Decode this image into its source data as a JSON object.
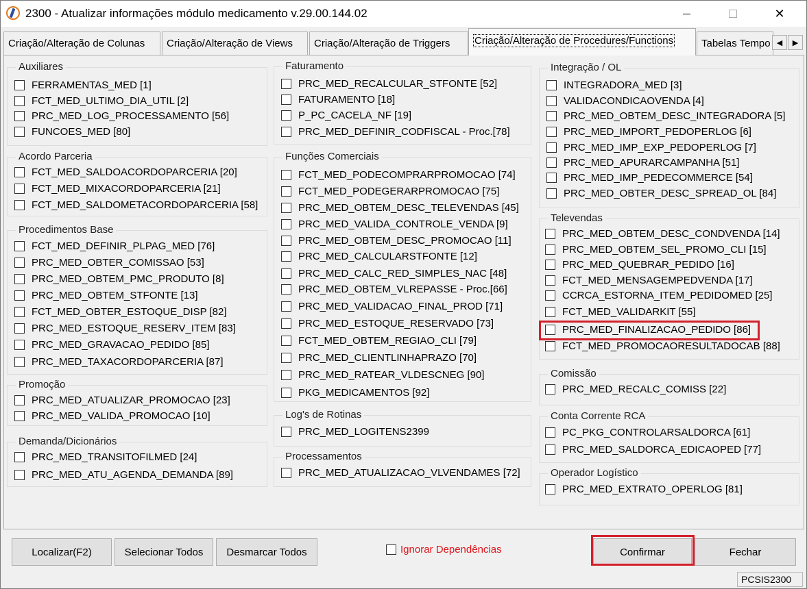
{
  "title": "2300 - Atualizar informações módulo medicamento v.29.00.144.02",
  "tabs": [
    "Criação/Alteração de Colunas",
    "Criação/Alteração de Views",
    "Criação/Alteração de Triggers",
    "Criação/Alteração de Procedures/Functions",
    "Tabelas Tempo"
  ],
  "groups": {
    "auxiliares": {
      "title": "Auxiliares",
      "items": [
        "FERRAMENTAS_MED [1]",
        "FCT_MED_ULTIMO_DIA_UTIL [2]",
        "PRC_MED_LOG_PROCESSAMENTO [56]",
        "FUNCOES_MED [80]"
      ]
    },
    "acordo": {
      "title": "Acordo Parceria",
      "items": [
        "FCT_MED_SALDOACORDOPARCERIA [20]",
        "FCT_MED_MIXACORDOPARCERIA [21]",
        "FCT_MED_SALDOMETACORDOPARCERIA [58]"
      ]
    },
    "procedimentos": {
      "title": "Procedimentos Base",
      "items": [
        "FCT_MED_DEFINIR_PLPAG_MED [76]",
        "PRC_MED_OBTER_COMISSAO [53]",
        "PRC_MED_OBTEM_PMC_PRODUTO [8]",
        "PRC_MED_OBTEM_STFONTE [13]",
        "FCT_MED_OBTER_ESTOQUE_DISP [82]",
        "PRC_MED_ESTOQUE_RESERV_ITEM [83]",
        "PRC_MED_GRAVACAO_PEDIDO [85]",
        "PRC_MED_TAXACORDOPARCERIA [87]"
      ]
    },
    "promocao": {
      "title": "Promoção",
      "items": [
        "PRC_MED_ATUALIZAR_PROMOCAO [23]",
        "PRC_MED_VALIDA_PROMOCAO [10]"
      ]
    },
    "demanda": {
      "title": "Demanda/Dicionários",
      "items": [
        "PRC_MED_TRANSITOFILMED [24]",
        "PRC_MED_ATU_AGENDA_DEMANDA [89]"
      ]
    },
    "faturamento": {
      "title": "Faturamento",
      "items": [
        "PRC_MED_RECALCULAR_STFONTE [52]",
        "FATURAMENTO [18]",
        "P_PC_CACELA_NF [19]",
        "PRC_MED_DEFINIR_CODFISCAL - Proc.[78]"
      ]
    },
    "comerciais": {
      "title": "Funções Comerciais",
      "items": [
        "FCT_MED_PODECOMPRARPROMOCAO [74]",
        "FCT_MED_PODEGERARPROMOCAO [75]",
        "PRC_MED_OBTEM_DESC_TELEVENDAS [45]",
        "PRC_MED_VALIDA_CONTROLE_VENDA [9]",
        "PRC_MED_OBTEM_DESC_PROMOCAO [11]",
        "PRC_MED_CALCULARSTFONTE [12]",
        "PRC_MED_CALC_RED_SIMPLES_NAC [48]",
        "PRC_MED_OBTEM_VLREPASSE - Proc.[66]",
        "PRC_MED_VALIDACAO_FINAL_PROD [71]",
        "PRC_MED_ESTOQUE_RESERVADO [73]",
        "FCT_MED_OBTEM_REGIAO_CLI [79]",
        "PRC_MED_CLIENTLINHAPRAZO [70]",
        "PRC_MED_RATEAR_VLDESCNEG [90]",
        "PKG_MEDICAMENTOS [92]"
      ]
    },
    "logs": {
      "title": "Log's de Rotinas",
      "items": [
        "PRC_MED_LOGITENS2399"
      ]
    },
    "processamentos": {
      "title": "Processamentos",
      "items": [
        "PRC_MED_ATUALIZACAO_VLVENDAMES [72]"
      ]
    },
    "integracao": {
      "title": "Integração / OL",
      "items": [
        "INTEGRADORA_MED [3]",
        "VALIDACONDICAOVENDA [4]",
        "PRC_MED_OBTEM_DESC_INTEGRADORA [5]",
        "PRC_MED_IMPORT_PEDOPERLOG [6]",
        "PRC_MED_IMP_EXP_PEDOPERLOG [7]",
        "PRC_MED_APURARCAMPANHA [51]",
        "PRC_MED_IMP_PEDECOMMERCE [54]",
        "PRC_MED_OBTER_DESC_SPREAD_OL [84]"
      ]
    },
    "televendas": {
      "title": "Televendas",
      "items": [
        "PRC_MED_OBTEM_DESC_CONDVENDA [14]",
        "PRC_MED_OBTEM_SEL_PROMO_CLI [15]",
        "PRC_MED_QUEBRAR_PEDIDO [16]",
        "FCT_MED_MENSAGEMPEDVENDA [17]",
        "CCRCA_ESTORNA_ITEM_PEDIDOMED [25]",
        "FCT_MED_VALIDARKIT [55]",
        "PRC_MED_FINALIZACAO_PEDIDO [86]",
        "FCT_MED_PROMOCAORESULTADOCAB [88]"
      ]
    },
    "comissao": {
      "title": "Comissão",
      "items": [
        "PRC_MED_RECALC_COMISS [22]"
      ]
    },
    "conta": {
      "title": "Conta Corrente RCA",
      "items": [
        "PC_PKG_CONTROLARSALDORCA [61]",
        "PRC_MED_SALDORCA_EDICAOPED [77]"
      ]
    },
    "operador": {
      "title": "Operador Logístico",
      "items": [
        "PRC_MED_EXTRATO_OPERLOG [81]"
      ]
    }
  },
  "buttons": {
    "localizar": "Localizar(F2)",
    "selecionar": "Selecionar Todos",
    "desmarcar": "Desmarcar Todos",
    "ignorar": "Ignorar Dependências",
    "confirmar": "Confirmar",
    "fechar": "Fechar"
  },
  "status": "PCSIS2300",
  "colors": {
    "highlight": "#d3202b",
    "ignore_text": "#e0151b"
  }
}
